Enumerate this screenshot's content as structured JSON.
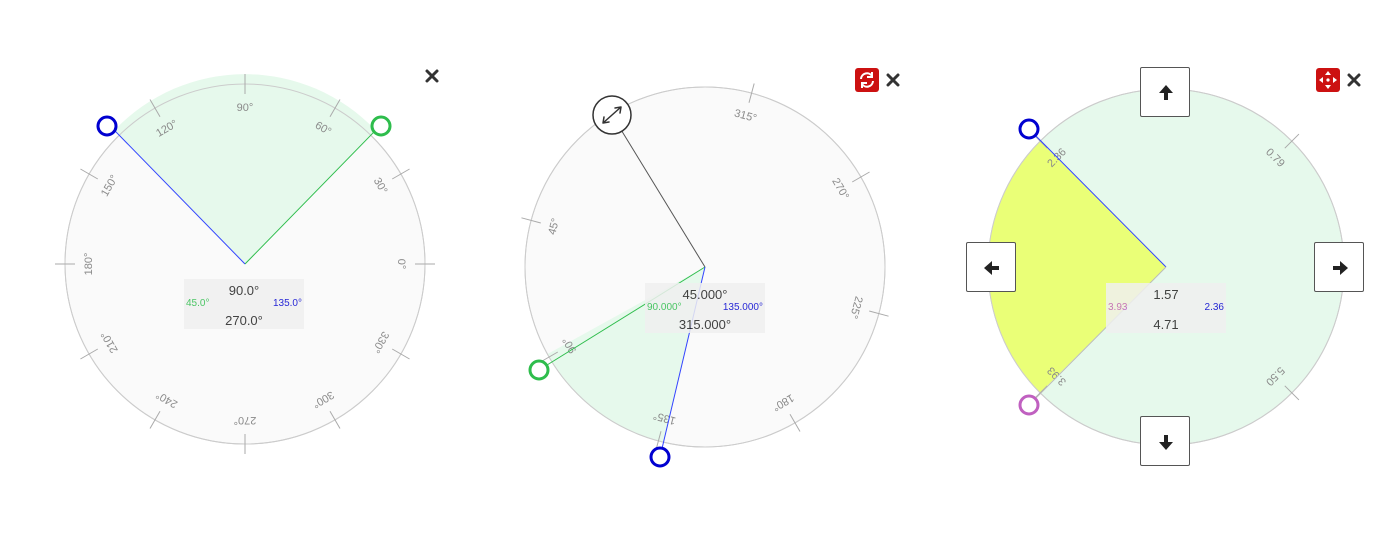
{
  "colors": {
    "green": "#2ebd4c",
    "blue": "#0000d0",
    "magenta": "#c060c0",
    "red": "#cc1111",
    "sector_green": "#e6f9ec",
    "sector_yellow": "#eaff77",
    "disc": "#fafafa"
  },
  "widgets": [
    {
      "id": "protractor-1",
      "close_icon": "close-icon",
      "readout": {
        "top": "90.0°",
        "bottom": "270.0°",
        "left": "45.0°",
        "right": "135.0°"
      },
      "tick_labels": [
        "0°",
        "30°",
        "60°",
        "90°",
        "120°",
        "150°",
        "180°",
        "210°",
        "240°",
        "270°",
        "300°",
        "330°"
      ]
    },
    {
      "id": "protractor-2",
      "mode_icon": "rotate-icon",
      "close_icon": "close-icon",
      "rotate_handle_icon": "double-arrow-icon",
      "readout": {
        "top": "45.000°",
        "bottom": "315.000°",
        "left": "90.000°",
        "right": "135.000°"
      },
      "tick_labels": [
        "45°",
        "90°",
        "135°",
        "180°",
        "225°",
        "270°",
        "315°"
      ]
    },
    {
      "id": "protractor-3",
      "mode_icon": "move-icon",
      "close_icon": "close-icon",
      "readout": {
        "top": "1.57",
        "bottom": "4.71",
        "left": "3.93",
        "right": "2.36"
      },
      "tick_labels": [
        "0.79",
        "2.36",
        "3.93",
        "5.50"
      ],
      "arrow_buttons": [
        "arrow-up-icon",
        "arrow-left-icon",
        "arrow-right-icon",
        "arrow-down-icon"
      ]
    }
  ]
}
